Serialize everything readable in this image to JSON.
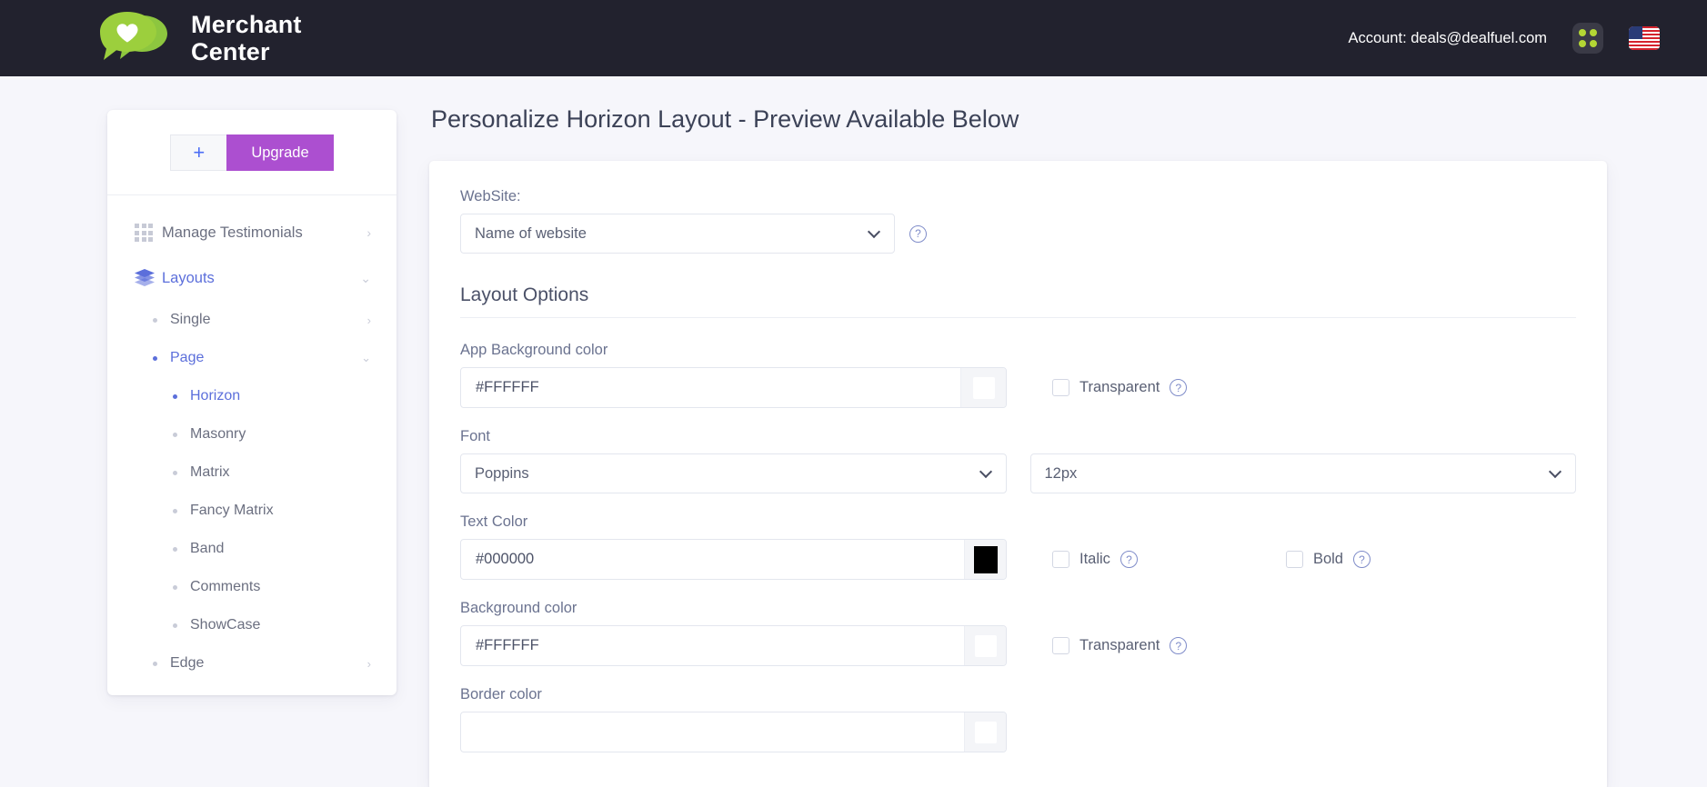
{
  "header": {
    "brand_line1": "Merchant",
    "brand_line2": "Center",
    "account_text": "Account: deals@dealfuel.com",
    "apps_icon": "grid-apps-icon",
    "flag_icon": "us-flag-icon",
    "logo_icon": "chat-bubbles-heart-logo",
    "bg_color": "#22222e",
    "logo_green": "#8dc63f"
  },
  "sidebar": {
    "plus_label": "+",
    "upgrade_label": "Upgrade",
    "upgrade_color": "#ac4fd0",
    "accent_color": "#5c6fdb",
    "nav": [
      {
        "label": "Manage Testimonials",
        "icon": "grid-icon",
        "chevron": "›",
        "active": false
      },
      {
        "label": "Layouts",
        "icon": "layers-icon",
        "chevron": "⌄",
        "active": true
      }
    ],
    "sub": [
      {
        "label": "Single",
        "level": 1,
        "chevron": "›",
        "active": false
      },
      {
        "label": "Page",
        "level": 1,
        "chevron": "⌄",
        "active": true
      },
      {
        "label": "Horizon",
        "level": 2,
        "chevron": "",
        "active": true
      },
      {
        "label": "Masonry",
        "level": 2,
        "chevron": "",
        "active": false
      },
      {
        "label": "Matrix",
        "level": 2,
        "chevron": "",
        "active": false
      },
      {
        "label": "Fancy Matrix",
        "level": 2,
        "chevron": "",
        "active": false
      },
      {
        "label": "Band",
        "level": 2,
        "chevron": "",
        "active": false
      },
      {
        "label": "Comments",
        "level": 2,
        "chevron": "",
        "active": false
      },
      {
        "label": "ShowCase",
        "level": 2,
        "chevron": "",
        "active": false
      },
      {
        "label": "Edge",
        "level": 1,
        "chevron": "›",
        "active": false
      }
    ]
  },
  "main": {
    "page_title": "Personalize Horizon Layout - Preview Available Below",
    "website": {
      "label": "WebSite:",
      "selected": "Name of website",
      "help": "?"
    },
    "section_title": "Layout Options",
    "app_background": {
      "label": "App Background color",
      "value": "#FFFFFF",
      "swatch_color": "#FFFFFF",
      "transparent_label": "Transparent",
      "transparent_checked": false,
      "help": "?"
    },
    "font": {
      "label": "Font",
      "family_selected": "Poppins",
      "size_selected": "12px"
    },
    "text_color": {
      "label": "Text Color",
      "value": "#000000",
      "swatch_color": "#000000",
      "italic_label": "Italic",
      "italic_checked": false,
      "bold_label": "Bold",
      "bold_checked": false,
      "help": "?"
    },
    "background_color": {
      "label": "Background color",
      "value": "#FFFFFF",
      "swatch_color": "#FFFFFF",
      "transparent_label": "Transparent",
      "transparent_checked": false,
      "help": "?"
    },
    "border_color": {
      "label": "Border color"
    }
  }
}
